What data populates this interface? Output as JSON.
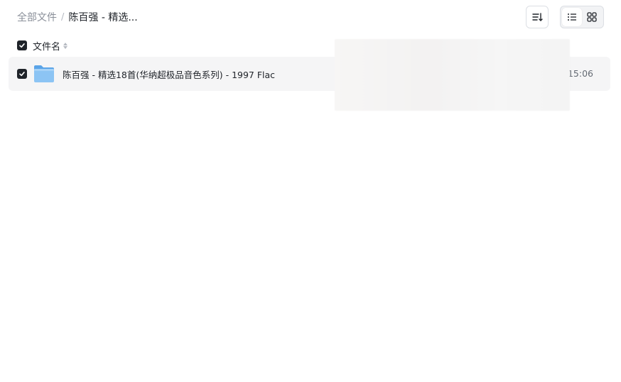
{
  "breadcrumb": {
    "root": "全部文件",
    "separator": "/",
    "current": "陈百强 - 精选..."
  },
  "toolbar": {
    "sort_icon": "sort-icon",
    "view_list_icon": "list-view-icon",
    "view_grid_icon": "grid-view-icon",
    "active_view": "list"
  },
  "list_header": {
    "checked": true,
    "column_name": "文件名"
  },
  "files": [
    {
      "name": "陈百强 - 精选18首(华纳超极品音色系列) - 1997 Flac",
      "type": "folder",
      "checked": true,
      "time": "15:06"
    }
  ],
  "colors": {
    "checkbox": "#1f2329",
    "folder": "#6fb3ef",
    "row_background": "#f5f5f6"
  }
}
